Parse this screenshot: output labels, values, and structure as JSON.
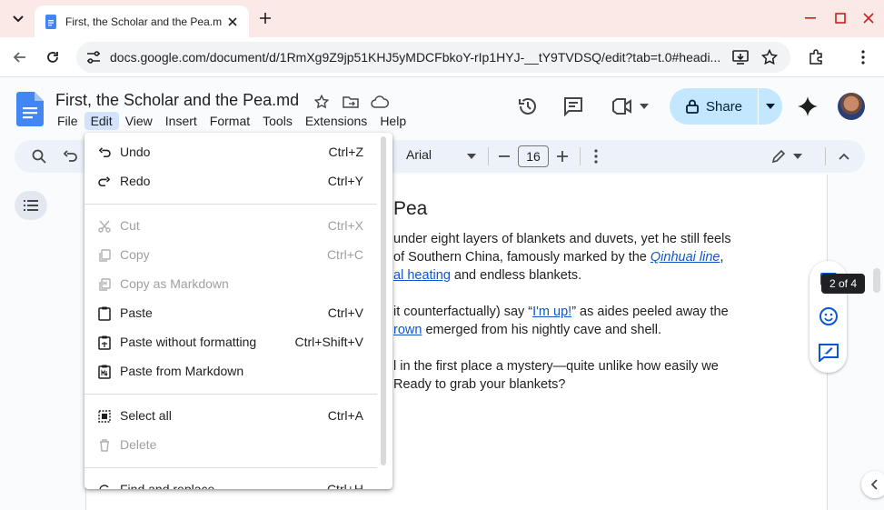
{
  "browser": {
    "tab_title": "First, the Scholar and the Pea.m",
    "url": "docs.google.com/document/d/1RmXg9Z9jp51KHJ5yMDCFbkoY-rIp1HYJ-__tY9TVDSQ/edit?tab=t.0#headi..."
  },
  "docs": {
    "title": "First, the Scholar and the Pea.md",
    "share_label": "Share",
    "menu": [
      "File",
      "Edit",
      "View",
      "Insert",
      "Format",
      "Tools",
      "Extensions",
      "Help"
    ],
    "toolbar": {
      "font": "Arial",
      "font_size": "16"
    }
  },
  "edit_menu": {
    "items": [
      {
        "label": "Undo",
        "shortcut": "Ctrl+Z",
        "icon": "undo-icon",
        "enabled": true
      },
      {
        "label": "Redo",
        "shortcut": "Ctrl+Y",
        "icon": "redo-icon",
        "enabled": true
      },
      {
        "label": "Cut",
        "shortcut": "Ctrl+X",
        "icon": "cut-icon",
        "enabled": false
      },
      {
        "label": "Copy",
        "shortcut": "Ctrl+C",
        "icon": "copy-icon",
        "enabled": false
      },
      {
        "label": "Copy as Markdown",
        "shortcut": "",
        "icon": "copy-markdown-icon",
        "enabled": false
      },
      {
        "label": "Paste",
        "shortcut": "Ctrl+V",
        "icon": "paste-icon",
        "enabled": true
      },
      {
        "label": "Paste without formatting",
        "shortcut": "Ctrl+Shift+V",
        "icon": "paste-plain-icon",
        "enabled": true
      },
      {
        "label": "Paste from Markdown",
        "shortcut": "",
        "icon": "paste-markdown-icon",
        "enabled": true
      },
      {
        "label": "Select all",
        "shortcut": "Ctrl+A",
        "icon": "select-all-icon",
        "enabled": true
      },
      {
        "label": "Delete",
        "shortcut": "",
        "icon": "delete-icon",
        "enabled": false
      },
      {
        "label": "Find and replace",
        "shortcut": "Ctrl+H",
        "icon": "find-replace-icon",
        "enabled": true
      }
    ]
  },
  "document": {
    "heading": "Pea",
    "line1": "under eight layers of blankets and duvets, yet he still feels",
    "line2_pre": "of Southern China, famously marked by the ",
    "line2_link": "Qinhuai line",
    "line2_post": ",",
    "line3_link": "al heating",
    "line3_post": " and endless blankets.",
    "line4_pre": "it counterfactually) say “",
    "line4_link": "I'm up!",
    "line4_post": "” as aides peeled away the",
    "line5_link": "rown",
    "line5_post": " emerged from his nightly cave and shell.",
    "line6": "l in the first place a mystery—quite unlike how easily we",
    "line7": "Ready to grab your blankets?"
  },
  "side": {
    "tooltip": "2 of 4"
  },
  "colors": {
    "tab_strip": "#fbe9e7",
    "share_bg": "#c2e7ff",
    "link": "#1155cc",
    "menu_active": "#d3e3fd"
  }
}
